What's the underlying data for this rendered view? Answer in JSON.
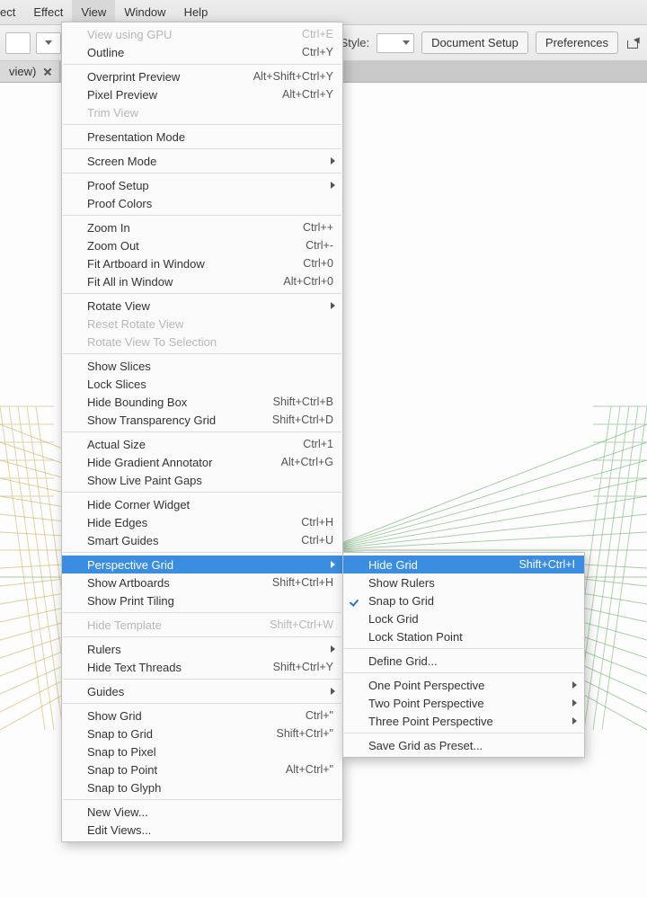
{
  "menubar": {
    "items": [
      "ect",
      "Effect",
      "View",
      "Window",
      "Help"
    ],
    "active_index": 2
  },
  "optionbar": {
    "style_label": "Style:",
    "buttons": {
      "doc_setup": "Document Setup",
      "prefs": "Preferences"
    }
  },
  "tabstrip": {
    "tab_label": "view)"
  },
  "view_menu": {
    "groups": [
      [
        {
          "label": "View using GPU",
          "shortcut": "Ctrl+E",
          "disabled": true
        },
        {
          "label": "Outline",
          "shortcut": "Ctrl+Y"
        }
      ],
      [
        {
          "label": "Overprint Preview",
          "shortcut": "Alt+Shift+Ctrl+Y"
        },
        {
          "label": "Pixel Preview",
          "shortcut": "Alt+Ctrl+Y"
        },
        {
          "label": "Trim View",
          "disabled": true
        }
      ],
      [
        {
          "label": "Presentation Mode"
        }
      ],
      [
        {
          "label": "Screen Mode",
          "submenu": true
        }
      ],
      [
        {
          "label": "Proof Setup",
          "submenu": true
        },
        {
          "label": "Proof Colors"
        }
      ],
      [
        {
          "label": "Zoom In",
          "shortcut": "Ctrl++"
        },
        {
          "label": "Zoom Out",
          "shortcut": "Ctrl+-"
        },
        {
          "label": "Fit Artboard in Window",
          "shortcut": "Ctrl+0"
        },
        {
          "label": "Fit All in Window",
          "shortcut": "Alt+Ctrl+0"
        }
      ],
      [
        {
          "label": "Rotate View",
          "submenu": true
        },
        {
          "label": "Reset Rotate View",
          "disabled": true
        },
        {
          "label": "Rotate View To Selection",
          "disabled": true
        }
      ],
      [
        {
          "label": "Show Slices"
        },
        {
          "label": "Lock Slices"
        },
        {
          "label": "Hide Bounding Box",
          "shortcut": "Shift+Ctrl+B"
        },
        {
          "label": "Show Transparency Grid",
          "shortcut": "Shift+Ctrl+D"
        }
      ],
      [
        {
          "label": "Actual Size",
          "shortcut": "Ctrl+1"
        },
        {
          "label": "Hide Gradient Annotator",
          "shortcut": "Alt+Ctrl+G"
        },
        {
          "label": "Show Live Paint Gaps"
        }
      ],
      [
        {
          "label": "Hide Corner Widget"
        },
        {
          "label": "Hide Edges",
          "shortcut": "Ctrl+H"
        },
        {
          "label": "Smart Guides",
          "shortcut": "Ctrl+U"
        }
      ],
      [
        {
          "label": "Perspective Grid",
          "submenu": true,
          "highlight": true
        },
        {
          "label": "Show Artboards",
          "shortcut": "Shift+Ctrl+H"
        },
        {
          "label": "Show Print Tiling"
        }
      ],
      [
        {
          "label": "Hide Template",
          "shortcut": "Shift+Ctrl+W",
          "disabled": true
        }
      ],
      [
        {
          "label": "Rulers",
          "submenu": true
        },
        {
          "label": "Hide Text Threads",
          "shortcut": "Shift+Ctrl+Y"
        }
      ],
      [
        {
          "label": "Guides",
          "submenu": true
        }
      ],
      [
        {
          "label": "Show Grid",
          "shortcut": "Ctrl+\""
        },
        {
          "label": "Snap to Grid",
          "shortcut": "Shift+Ctrl+\""
        },
        {
          "label": "Snap to Pixel"
        },
        {
          "label": "Snap to Point",
          "shortcut": "Alt+Ctrl+\""
        },
        {
          "label": "Snap to Glyph"
        }
      ],
      [
        {
          "label": "New View..."
        },
        {
          "label": "Edit Views..."
        }
      ]
    ]
  },
  "perspective_submenu": {
    "groups": [
      [
        {
          "label": "Hide Grid",
          "shortcut": "Shift+Ctrl+I",
          "highlight": true
        },
        {
          "label": "Show Rulers"
        },
        {
          "label": "Snap to Grid",
          "checked": true
        },
        {
          "label": "Lock Grid"
        },
        {
          "label": "Lock Station Point"
        }
      ],
      [
        {
          "label": "Define Grid..."
        }
      ],
      [
        {
          "label": "One Point Perspective",
          "submenu": true
        },
        {
          "label": "Two Point Perspective",
          "submenu": true
        },
        {
          "label": "Three Point Perspective",
          "submenu": true
        }
      ],
      [
        {
          "label": "Save Grid as Preset..."
        }
      ]
    ]
  }
}
